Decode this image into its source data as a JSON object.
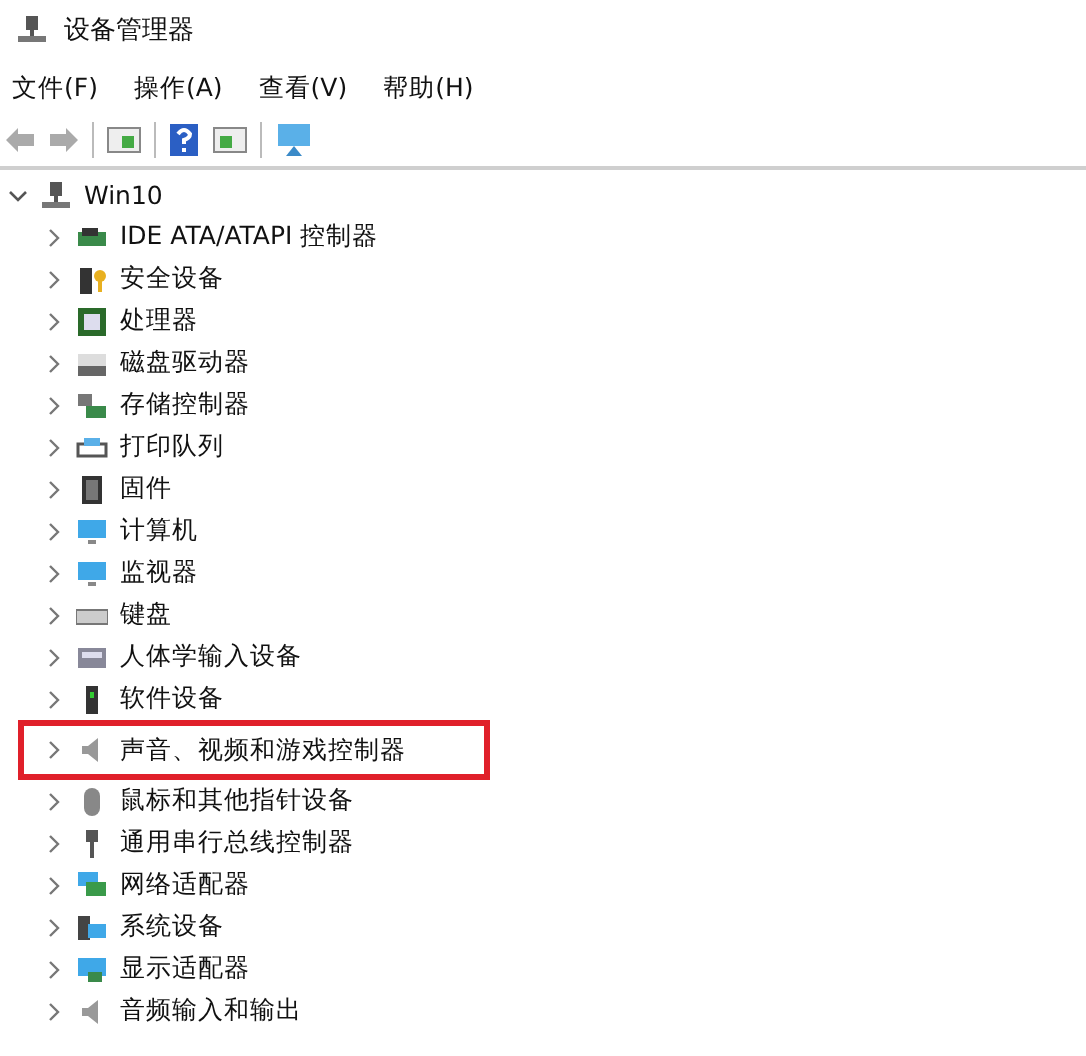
{
  "window": {
    "title": "设备管理器"
  },
  "menu": [
    "文件(F)",
    "操作(A)",
    "查看(V)",
    "帮助(H)"
  ],
  "tree": {
    "label": "Win10",
    "expanded": true,
    "children": [
      {
        "label": "IDE ATA/ATAPI 控制器",
        "expanded": false,
        "highlighted": false
      },
      {
        "label": "安全设备",
        "expanded": false,
        "highlighted": false
      },
      {
        "label": "处理器",
        "expanded": false,
        "highlighted": false
      },
      {
        "label": "磁盘驱动器",
        "expanded": false,
        "highlighted": false
      },
      {
        "label": "存储控制器",
        "expanded": false,
        "highlighted": false
      },
      {
        "label": "打印队列",
        "expanded": false,
        "highlighted": false
      },
      {
        "label": "固件",
        "expanded": false,
        "highlighted": false
      },
      {
        "label": "计算机",
        "expanded": false,
        "highlighted": false
      },
      {
        "label": "监视器",
        "expanded": false,
        "highlighted": false
      },
      {
        "label": "键盘",
        "expanded": false,
        "highlighted": false
      },
      {
        "label": "人体学输入设备",
        "expanded": false,
        "highlighted": false
      },
      {
        "label": "软件设备",
        "expanded": false,
        "highlighted": false
      },
      {
        "label": "声音、视频和游戏控制器",
        "expanded": false,
        "highlighted": true
      },
      {
        "label": "鼠标和其他指针设备",
        "expanded": false,
        "highlighted": false
      },
      {
        "label": "通用串行总线控制器",
        "expanded": false,
        "highlighted": false
      },
      {
        "label": "网络适配器",
        "expanded": false,
        "highlighted": false
      },
      {
        "label": "系统设备",
        "expanded": false,
        "highlighted": false
      },
      {
        "label": "显示适配器",
        "expanded": false,
        "highlighted": false
      },
      {
        "label": "音频输入和输出",
        "expanded": false,
        "highlighted": false
      }
    ]
  }
}
